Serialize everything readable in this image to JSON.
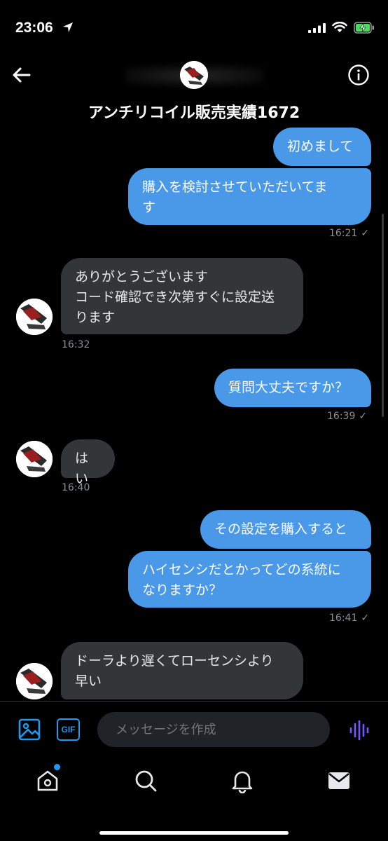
{
  "status": {
    "time": "23:06",
    "icons": [
      "location-arrow-icon",
      "signal-icon",
      "wifi-icon",
      "battery-charging-icon"
    ]
  },
  "header": {
    "title": "アンチリコイル販売実績1672",
    "back_icon": "back-arrow-icon",
    "info_icon": "info-icon"
  },
  "messages": [
    {
      "side": "me",
      "text": "初めまして"
    },
    {
      "side": "me",
      "text": "購入を検討させていただいてます"
    },
    {
      "side": "me",
      "time": "16:21"
    },
    {
      "side": "them",
      "text": "ありがとうございます\nコード確認でき次第すぐに設定送ります",
      "time": "16:32"
    },
    {
      "side": "me",
      "text": "質問大丈夫ですか？",
      "time": "16:39"
    },
    {
      "side": "them",
      "text": "はい",
      "time": "16:40"
    },
    {
      "side": "me",
      "text": "その設定を購入すると"
    },
    {
      "side": "me",
      "text": "ハイセンシだとかってどの系統になりますか？",
      "time": "16:41"
    },
    {
      "side": "them",
      "text": "ドーラより遅くてローセンシより早い"
    }
  ],
  "bubbles": {
    "b1": "初めまして",
    "b2_l1": "購入を検討させていただいてま",
    "b2_l2": "す",
    "t1": "16:21",
    "b3_l1": "ありがとうございます",
    "b3_l2": "コード確認でき次第すぐに設定送",
    "b3_l3": "ります",
    "t2": "16:32",
    "b4": "質問大丈夫ですか？",
    "t3": "16:39",
    "b5": "はい",
    "t4": "16:40",
    "b6": "その設定を購入すると",
    "b7_l1": "ハイセンシだとかってどの系統に",
    "b7_l2": "なりますか？",
    "t5": "16:41",
    "b8_l1": "ドーラより遅くてローセンシより",
    "b8_l2": "早い",
    "check": "✓"
  },
  "composer": {
    "placeholder": "メッセージを作成",
    "gif_label": "GIF",
    "image_icon": "image-icon",
    "voice_icon": "voice-waveform-icon"
  },
  "tabs": [
    "home-icon",
    "search-icon",
    "notifications-bell-icon",
    "messages-envelope-icon"
  ],
  "colors": {
    "background": "#000000",
    "my_bubble": "#4a99e9",
    "their_bubble": "#333639",
    "accent": "#1d9bf0",
    "voice": "#7856ff"
  }
}
